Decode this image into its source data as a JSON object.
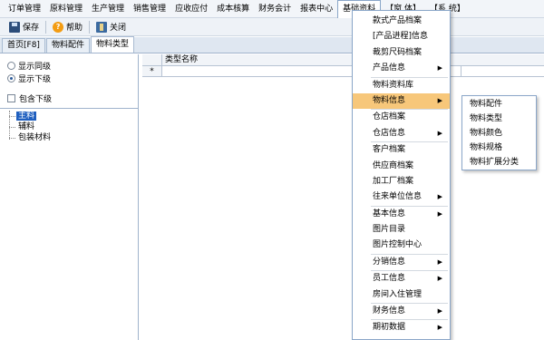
{
  "menubar": {
    "items": [
      {
        "label": "订单管理"
      },
      {
        "label": "原料管理"
      },
      {
        "label": "生产管理"
      },
      {
        "label": "销售管理"
      },
      {
        "label": "应收应付"
      },
      {
        "label": "成本核算"
      },
      {
        "label": "财务会计"
      },
      {
        "label": "报表中心"
      },
      {
        "label": "基础资料",
        "active": true
      },
      {
        "label": "【窗 体】"
      },
      {
        "label": "【系 统】"
      }
    ]
  },
  "toolbar": {
    "save_label": "保存",
    "help_label": "帮助",
    "close_label": "关闭"
  },
  "tabs": [
    {
      "label": "首页[F8]"
    },
    {
      "label": "物料配件"
    },
    {
      "label": "物料类型",
      "active": true
    }
  ],
  "options": {
    "same_level": "显示同级",
    "lower_level": "显示下级",
    "include_lower": "包含下级",
    "selected": "lower_level"
  },
  "tree": {
    "items": [
      {
        "label": "主料",
        "selected": true
      },
      {
        "label": "辅料"
      },
      {
        "label": "包装材料"
      }
    ]
  },
  "grid": {
    "column": "类型名称",
    "new_row_marker": "*"
  },
  "dropdown": {
    "items": [
      {
        "label": "款式产品档案"
      },
      {
        "label": "[产品进程]信息"
      },
      {
        "label": "裁剪尺码档案"
      },
      {
        "label": "产品信息",
        "submenu": true
      },
      {
        "sep": true
      },
      {
        "label": "物料资料库"
      },
      {
        "label": "物料信息",
        "submenu": true,
        "active": true
      },
      {
        "sep": true
      },
      {
        "label": "仓店档案"
      },
      {
        "label": "仓店信息",
        "submenu": true
      },
      {
        "sep": true
      },
      {
        "label": "客户档案"
      },
      {
        "label": "供应商档案"
      },
      {
        "label": "加工厂档案"
      },
      {
        "label": "往来单位信息",
        "submenu": true
      },
      {
        "sep": true
      },
      {
        "label": "基本信息",
        "submenu": true
      },
      {
        "label": "图片目录"
      },
      {
        "label": "图片控制中心"
      },
      {
        "sep": true
      },
      {
        "label": "分销信息",
        "submenu": true
      },
      {
        "sep": true
      },
      {
        "label": "员工信息",
        "submenu": true
      },
      {
        "label": "房间入住管理"
      },
      {
        "sep": true
      },
      {
        "label": "财务信息",
        "submenu": true
      },
      {
        "sep": true
      },
      {
        "label": "期初数据",
        "submenu": true
      }
    ],
    "arrow": "▶"
  },
  "submenu": {
    "items": [
      {
        "label": "物料配件"
      },
      {
        "label": "物料类型"
      },
      {
        "label": "物料颜色"
      },
      {
        "label": "物料规格"
      },
      {
        "label": "物料扩展分类"
      }
    ]
  },
  "colors": {
    "accent": "#1f5fbf",
    "menu_highlight": "#f7c77a"
  }
}
